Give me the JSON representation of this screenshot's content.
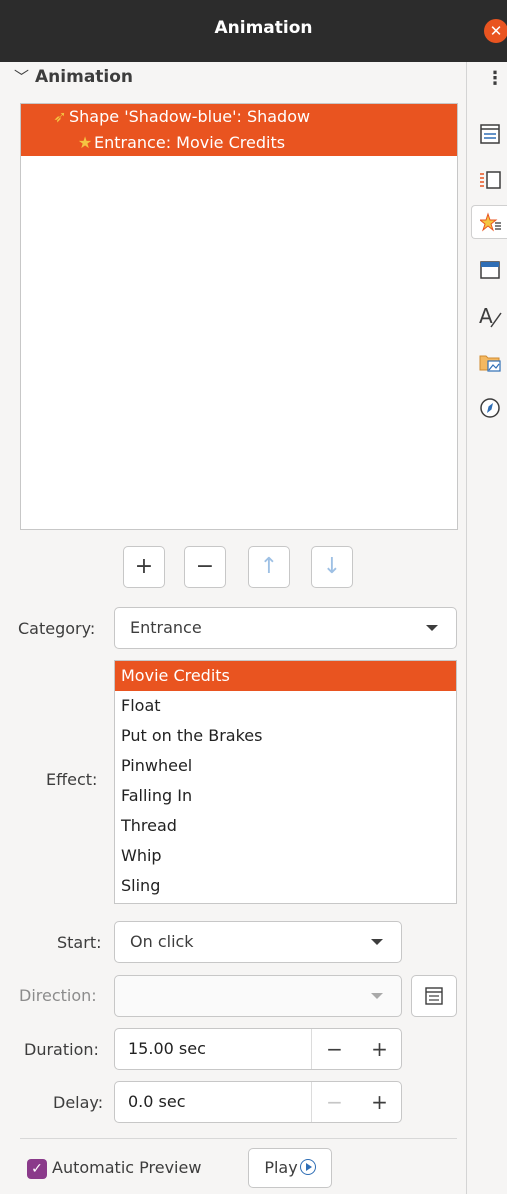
{
  "window": {
    "title": "Animation"
  },
  "panel": {
    "header": "Animation"
  },
  "animation_list": [
    {
      "label": "Shape 'Shadow-blue': Shadow"
    },
    {
      "label": "Entrance: Movie Credits"
    }
  ],
  "list_buttons": {
    "add": "+",
    "remove": "−",
    "move_up": "↑",
    "move_down": "↓"
  },
  "category": {
    "label": "Category:",
    "value": "Entrance"
  },
  "effect": {
    "label": "Effect:",
    "options": [
      "Movie Credits",
      "Float",
      "Put on the Brakes",
      "Pinwheel",
      "Falling In",
      "Thread",
      "Whip",
      "Sling"
    ],
    "selected": "Movie Credits"
  },
  "start": {
    "label": "Start:",
    "value": "On click"
  },
  "direction": {
    "label": "Direction:",
    "value": ""
  },
  "duration": {
    "label": "Duration:",
    "value": "15.00 sec",
    "minus": "−",
    "plus": "+"
  },
  "delay": {
    "label": "Delay:",
    "value": "0.0 sec",
    "minus": "−",
    "plus": "+"
  },
  "automatic_preview": {
    "label": "Automatic Preview",
    "checked": true
  },
  "play": {
    "label": "Play"
  },
  "colors": {
    "accent": "#e95420",
    "checkbox": "#8a3a8a",
    "titlebar": "#2c2c2c"
  }
}
